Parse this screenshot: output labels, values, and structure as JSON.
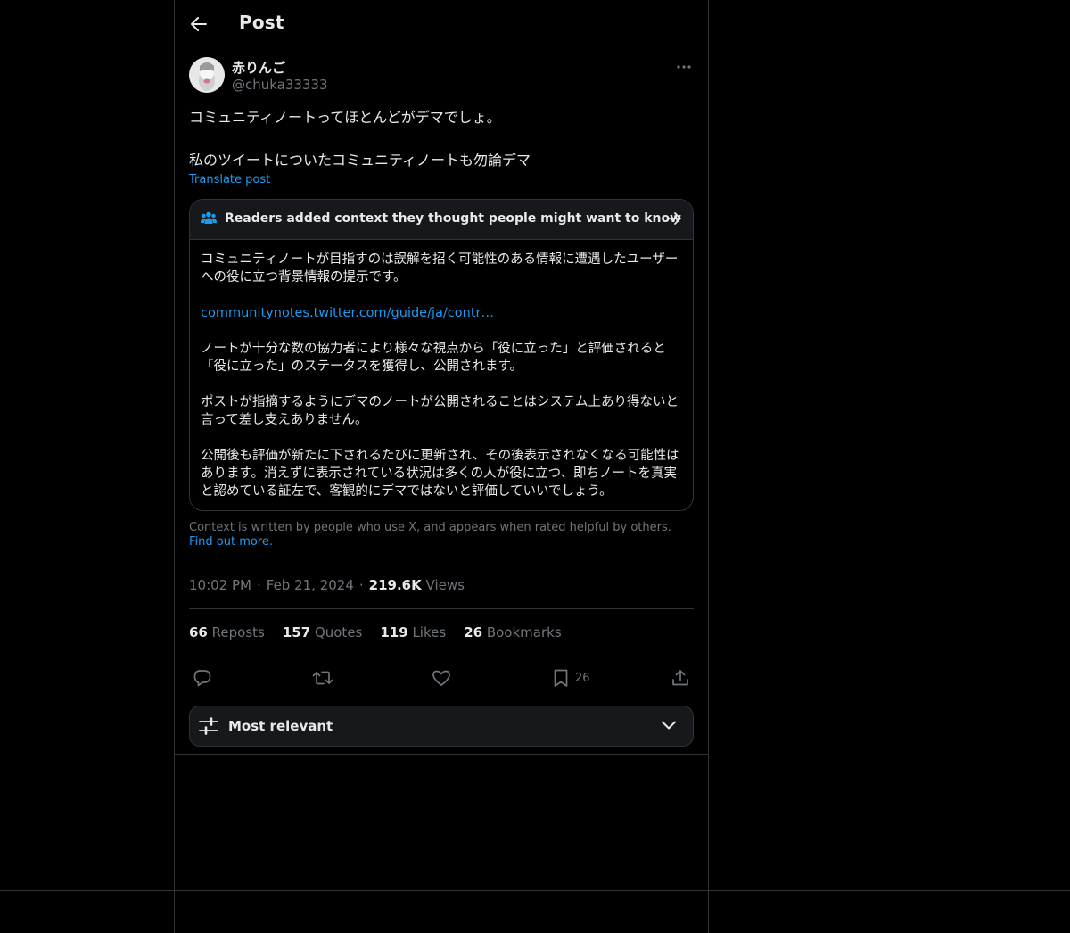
{
  "header": {
    "title": "Post",
    "back_icon": "arrow-left-icon"
  },
  "post": {
    "author": {
      "display_name": "赤りんご",
      "handle": "@chuka33333"
    },
    "text": "コミュニティノートってほとんどがデマでしょ。\n\n私のツイートについたコミュニティノートも勿論デマ",
    "translate_label": "Translate post",
    "timestamp": {
      "time": "10:02 PM",
      "date": "Feb 21, 2024",
      "views_count": "219.6K",
      "views_label": "Views"
    },
    "stats": [
      {
        "count": "66",
        "label": "Reposts"
      },
      {
        "count": "157",
        "label": "Quotes"
      },
      {
        "count": "119",
        "label": "Likes"
      },
      {
        "count": "26",
        "label": "Bookmarks"
      }
    ],
    "actions": {
      "bookmark_count": "26"
    }
  },
  "community_note": {
    "title": "Readers added context they thought people might want to know",
    "paragraphs": [
      "コミュニティノートが目指すのは誤解を招く可能性のある情報に遭遇したユーザーへの役に立つ背景情報の提示です。",
      "communitynotes.twitter.com/guide/ja/contr…",
      "ノートが十分な数の協力者により様々な視点から「役に立った」と評価されると「役に立った」のステータスを獲得し、公開されます。",
      "ポストが指摘するようにデマのノートが公開されることはシステム上あり得ないと言って差し支えありません。",
      "公開後も評価が新たに下されるたびに更新され、その後表示されなくなる可能性はあります。消えずに表示されている状況は多くの人が役に立つ、即ちノートを真実と認めている証左で、客観的にデマではないと評価していいでしょう。"
    ],
    "footer_text": "Context is written by people who use X, and appears when rated helpful by others.",
    "footer_link": "Find out more."
  },
  "replies": {
    "sort_label": "Most relevant"
  },
  "colors": {
    "background": "#000000",
    "text": "#e7e9ea",
    "muted": "#71767b",
    "accent": "#1d9bf0",
    "border": "#2f3336",
    "card": "#16181c"
  }
}
